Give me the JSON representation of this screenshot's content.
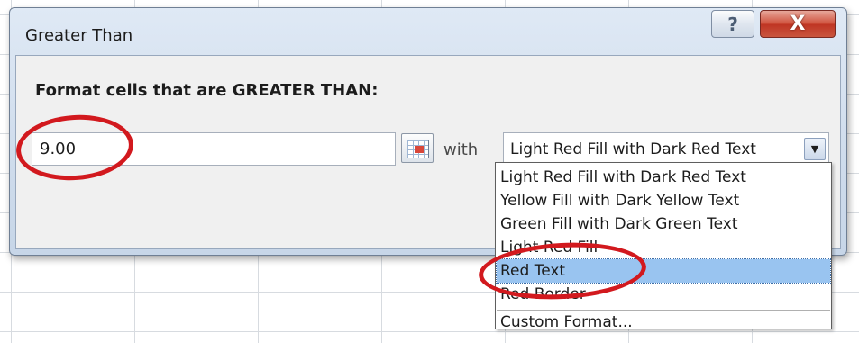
{
  "dialog": {
    "title": "Greater Than",
    "help_glyph": "?",
    "close_glyph": "X",
    "prompt": "Format cells that are GREATER THAN:",
    "value": "9.00",
    "with_label": "with",
    "selected_format": "Light Red Fill with Dark Red Text",
    "dropdown_arrow": "▼",
    "options": [
      "Light Red Fill with Dark Red Text",
      "Yellow Fill with Dark Yellow Text",
      "Green Fill with Dark Green Text",
      "Light Red Fill",
      "Red Text",
      "Red Border",
      "Custom Format..."
    ],
    "highlighted_option": "Red Text"
  },
  "colors": {
    "annotation": "#d2191e",
    "highlight": "#99c4f0",
    "close_button": "#c9553e"
  },
  "icons": [
    "help-icon",
    "close-icon",
    "range-selector-icon",
    "chevron-down-icon"
  ]
}
